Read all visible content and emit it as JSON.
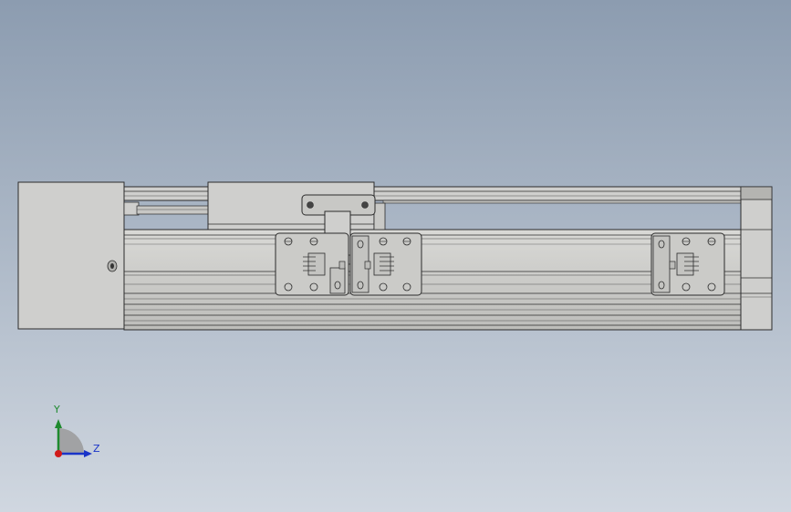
{
  "view": {
    "background_top": "#8c9cb0",
    "background_bottom": "#d0d7e0",
    "part_fill": "#cfcfcd",
    "part_fill_dark": "#b9b9b6",
    "edge_color": "#2b2b2b"
  },
  "triad": {
    "y_label": "Y",
    "z_label": "Z",
    "y_color": "#1e8a2e",
    "z_color": "#1a34c8",
    "x_color": "#d11a1a"
  }
}
